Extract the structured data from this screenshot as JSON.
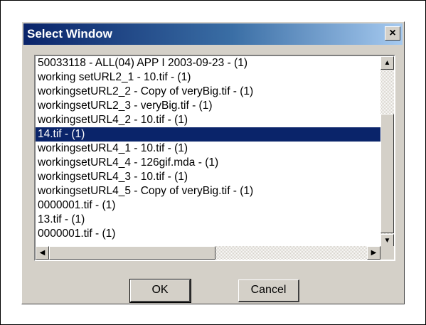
{
  "dialog": {
    "title": "Select Window",
    "close_label": "×"
  },
  "list": {
    "items": [
      "50033118 - ALL(04) APP I 2003-09-23 - (1)",
      "working setURL2_1 - 10.tif - (1)",
      "workingsetURL2_2 - Copy of veryBig.tif - (1)",
      "workingsetURL2_3 - veryBig.tif - (1)",
      "workingsetURL4_2 - 10.tif - (1)",
      "14.tif - (1)",
      "workingsetURL4_1 - 10.tif - (1)",
      "workingsetURL4_4 - 126gif.mda - (1)",
      "workingsetURL4_3 - 10.tif - (1)",
      "workingsetURL4_5 - Copy of veryBig.tif - (1)",
      "0000001.tif - (1)",
      "13.tif - (1)",
      "0000001.tif - (1)"
    ],
    "selected_item": "14.tif - (1)"
  },
  "scrollbars": {
    "up_arrow": "▲",
    "down_arrow": "▼",
    "left_arrow": "◀",
    "right_arrow": "▶"
  },
  "buttons": {
    "ok_label": "OK",
    "cancel_label": "Cancel"
  },
  "colors": {
    "title_bar": "#0a246a",
    "selection": "#0a246a",
    "face": "#d4d0c8"
  }
}
